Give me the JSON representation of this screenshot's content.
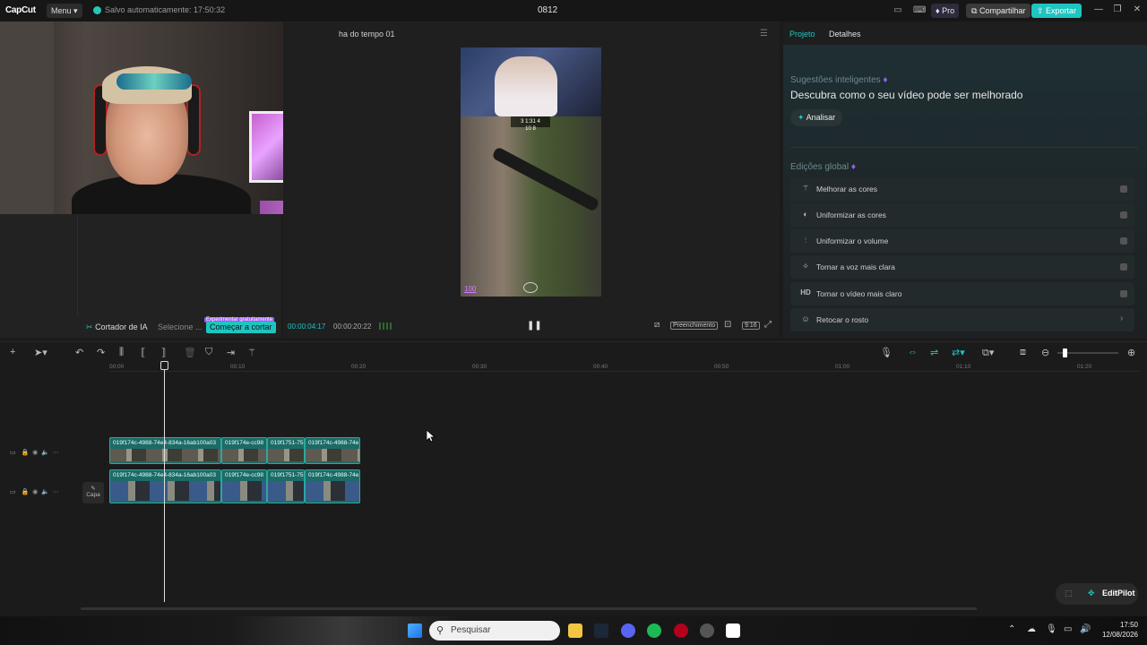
{
  "app": {
    "logo": "CapCut",
    "menu_label": "Menu",
    "save_status": "Salvo automaticamente: 17:50:32",
    "project_name": "0812",
    "pro_label": "Pro",
    "share_label": "Compartilhar",
    "export_label": "Exportar"
  },
  "media": {
    "ai_cutter_label": "Cortador de IA",
    "select_label": "Selecione ...",
    "start_cut_label": "Começar a cortar",
    "badge_label": "Experimentar gratuitamente"
  },
  "player": {
    "title": "ha do tempo 01",
    "current_time": "00:00:04:17",
    "total_time": "00:00:20:22",
    "fill_label": "Preenchimento",
    "ratio_label": "9:16",
    "hud_text": "3  1:31  4",
    "hud_sub": "10  8",
    "hp_value": "100"
  },
  "right_panel": {
    "tabs": [
      {
        "label": "Projeto",
        "active": true
      },
      {
        "label": "Detalhes",
        "active": false
      }
    ],
    "suggestions_title": "Sugestões inteligentes",
    "suggestions_desc": "Descubra como o seu vídeo pode ser melhorado",
    "analyze_label": "Analisar",
    "global_title": "Edições global",
    "items": [
      {
        "label": "Melhorar as cores",
        "icon": "magic-wand-icon",
        "control": "toggle"
      },
      {
        "label": "Uniformizar as cores",
        "icon": "palette-icon",
        "control": "toggle"
      },
      {
        "label": "Uniformizar o volume",
        "icon": "sliders-icon",
        "control": "toggle"
      },
      {
        "label": "Tornar a voz mais clara",
        "icon": "sparkle-icon",
        "control": "toggle"
      },
      {
        "label": "Tornar o vídeo mais claro",
        "icon": "hd-icon",
        "control": "toggle"
      },
      {
        "label": "Retocar o rosto",
        "icon": "face-icon",
        "control": "chevron"
      }
    ]
  },
  "timeline": {
    "ruler": [
      "00:00",
      "00:10",
      "00:20",
      "00:30",
      "00:40",
      "00:50",
      "01:00",
      "01:10",
      "01:20"
    ],
    "cover_label": "Capa",
    "track1_clips": [
      "019f174c-4988-74e4-834a-16ab100a03",
      "019f174e-cc98",
      "019f1751-75",
      "019f174c-4988-74e"
    ],
    "track2_clips": [
      "019f174c-4988-74e4-834a-16ab100a03",
      "019f174e-cc98",
      "019f1751-75",
      "019f174c-4988-74e"
    ],
    "editpilot_label": "EditPilot"
  },
  "taskbar": {
    "search_label": "Pesquisar",
    "time": "17:50",
    "date": "12/08/2026"
  },
  "colors": {
    "accent": "#1fc5c0",
    "clip": "#1d6b66",
    "pro": "#9d5cff"
  }
}
